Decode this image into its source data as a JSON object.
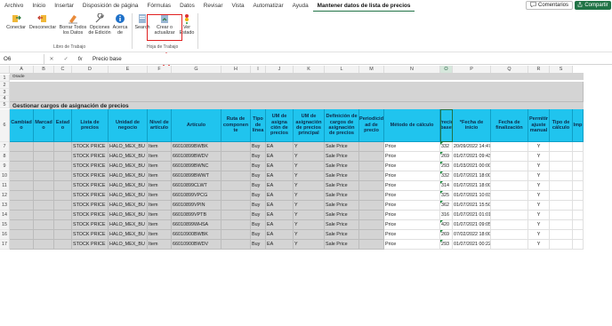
{
  "menu": {
    "items": [
      "Archivo",
      "Inicio",
      "Insertar",
      "Disposición de página",
      "Fórmulas",
      "Datos",
      "Revisar",
      "Vista",
      "Automatizar",
      "Ayuda",
      "Mantener datos de lista de precios"
    ],
    "active_index": 10,
    "comments_label": "Comentarios",
    "share_label": "Compartir"
  },
  "ribbon": {
    "group1_label": "Libro de Trabajo",
    "group2_label": "Hoja de Trabajo",
    "buttons": {
      "connect": "Conectar",
      "disconnect": "Desconectar",
      "clear_all": "Borrar Todos los Datos",
      "edit_options": "Opciones de Edición",
      "about": "Acerca de",
      "search": "Search",
      "create_update": "Crear o actualizar",
      "view_status": "Ver Estado"
    }
  },
  "formula_bar": {
    "name_box": "O6",
    "cancel": "✕",
    "confirm": "✓",
    "fx": "fx",
    "formula": "Precio base"
  },
  "grid": {
    "columns": [
      "A",
      "B",
      "C",
      "D",
      "E",
      "F",
      "G",
      "H",
      "I",
      "J",
      "K",
      "L",
      "M",
      "N",
      "O",
      "P",
      "Q",
      "R",
      "S"
    ],
    "selected_column": "O",
    "rows": [
      "1",
      "2",
      "3",
      "4",
      "5",
      "6",
      "7",
      "8",
      "9",
      "10",
      "11",
      "12",
      "13",
      "14",
      "15",
      "16",
      "17"
    ],
    "oracle_label": "Oracle",
    "sheet_title": "Gestionar cargos de asignación de precios",
    "headers": [
      "Cambiad o",
      "Marcad o",
      "Estad o",
      "Lista de precios",
      "Unidad de negocio",
      "Nivel de artículo",
      "Artículo",
      "Ruta de componen te",
      "Tipo de línea",
      "UM de asigna ción de precios",
      "UM de asignación de precios principal",
      "Definición de cargos de asignación de precios",
      "Periodicid ad de precio",
      "Método de cálculo",
      "Precio base",
      "*Fecha de inicio",
      "Fecha de finalización",
      "Permitir ajuste manual",
      "Tipo de cálculo",
      "Imp"
    ],
    "data_rows": [
      {
        "list": "STOCK PRICE",
        "bu": "HALO_MEX_BU",
        "level": "Item",
        "item": "66010899BWBK",
        "line": "Buy",
        "um": "EA",
        "um_main": "Y",
        "def": "Sale Price",
        "method": "Price",
        "price": "332",
        "start": "20/09/2022 14:47",
        "manual": "Y"
      },
      {
        "list": "STOCK PRICE",
        "bu": "HALO_MEX_BU",
        "level": "Item",
        "item": "66010899BWDV",
        "line": "Buy",
        "um": "EA",
        "um_main": "Y",
        "def": "Sale Price",
        "method": "Price",
        "price": "269",
        "start": "01/07/2021 09:43",
        "manual": "Y"
      },
      {
        "list": "STOCK PRICE",
        "bu": "HALO_MEX_BU",
        "level": "Item",
        "item": "66010899BWNC",
        "line": "Buy",
        "um": "EA",
        "um_main": "Y",
        "def": "Sale Price",
        "method": "Price",
        "price": "293",
        "start": "01/03/2021 00:00",
        "manual": "Y"
      },
      {
        "list": "STOCK PRICE",
        "bu": "HALO_MEX_BU",
        "level": "Item",
        "item": "66010899BWWT",
        "line": "Buy",
        "um": "EA",
        "um_main": "Y",
        "def": "Sale Price",
        "method": "Price",
        "price": "332",
        "start": "01/07/2021 18:00",
        "manual": "Y"
      },
      {
        "list": "STOCK PRICE",
        "bu": "HALO_MEX_BU",
        "level": "Item",
        "item": "66010899CLWT",
        "line": "Buy",
        "um": "EA",
        "um_main": "Y",
        "def": "Sale Price",
        "method": "Price",
        "price": "314",
        "start": "01/07/2021 18:00",
        "manual": "Y"
      },
      {
        "list": "STOCK PRICE",
        "bu": "HALO_MEX_BU",
        "level": "Item",
        "item": "66010899VPCG",
        "line": "Buy",
        "um": "EA",
        "um_main": "Y",
        "def": "Sale Price",
        "method": "Price",
        "price": "325",
        "start": "01/07/2021 10:03",
        "manual": "Y"
      },
      {
        "list": "STOCK PRICE",
        "bu": "HALO_MEX_BU",
        "level": "Item",
        "item": "66010899VPIN",
        "line": "Buy",
        "um": "EA",
        "um_main": "Y",
        "def": "Sale Price",
        "method": "Price",
        "price": "362",
        "start": "01/07/2021 15:50",
        "manual": "Y"
      },
      {
        "list": "STOCK PRICE",
        "bu": "HALO_MEX_BU",
        "level": "Item",
        "item": "66010899VPTB",
        "line": "Buy",
        "um": "EA",
        "um_main": "Y",
        "def": "Sale Price",
        "method": "Price",
        "price": "316",
        "start": "01/07/2021 01:01",
        "manual": "Y"
      },
      {
        "list": "STOCK PRICE",
        "bu": "HALO_MEX_BU",
        "level": "Item",
        "item": "66010899WHSA",
        "line": "Buy",
        "um": "EA",
        "um_main": "Y",
        "def": "Sale Price",
        "method": "Price",
        "price": "420",
        "start": "01/07/2021 09:05",
        "manual": "Y"
      },
      {
        "list": "STOCK PRICE",
        "bu": "HALO_MEX_BU",
        "level": "Item",
        "item": "66010900BWBK",
        "line": "Buy",
        "um": "EA",
        "um_main": "Y",
        "def": "Sale Price",
        "method": "Price",
        "price": "269",
        "start": "07/02/2022 18:00",
        "manual": "Y"
      },
      {
        "list": "STOCK PRICE",
        "bu": "HALO_MEX_BU",
        "level": "Item",
        "item": "66010900BWDV",
        "line": "Buy",
        "um": "EA",
        "um_main": "Y",
        "def": "Sale Price",
        "method": "Price",
        "price": "293",
        "start": "01/07/2021 00:22",
        "manual": "Y"
      }
    ]
  },
  "colors": {
    "excel_green": "#217346",
    "header_cyan": "#20c4ee",
    "gray_fill": "#d4d4d4",
    "highlight_red": "#e02020"
  }
}
